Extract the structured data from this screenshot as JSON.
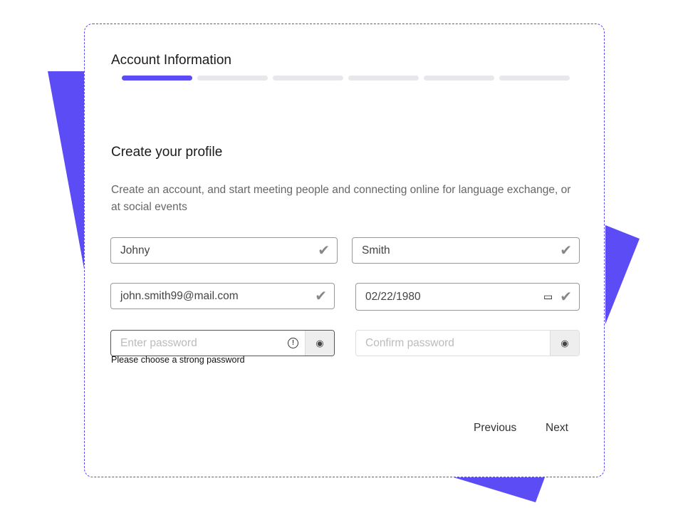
{
  "header": {
    "title": "Account Information",
    "steps_total": 6,
    "current_step": 1
  },
  "section": {
    "title": "Create your profile",
    "description": "Create an account, and start meeting people and connecting online for language exchange, or at social events"
  },
  "form": {
    "first_name": "Johny",
    "last_name": "Smith",
    "email": "john.smith99@mail.com",
    "birthdate": "02/22/1980",
    "password_placeholder": "Enter password",
    "password_hint": "Please choose a strong password",
    "confirm_placeholder": "Confirm password"
  },
  "nav": {
    "previous": "Previous",
    "next": "Next"
  },
  "colors": {
    "accent": "#5b4cf5"
  }
}
